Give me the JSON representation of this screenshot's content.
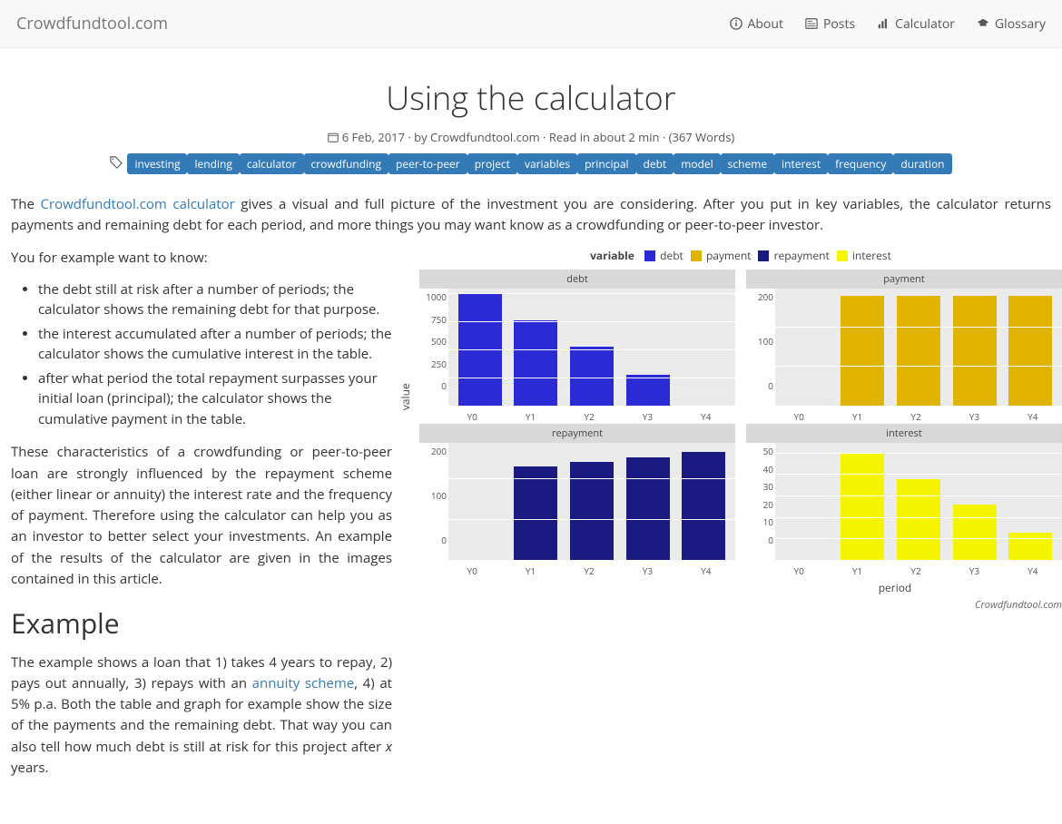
{
  "nav": {
    "brand": "Crowdfundtool.com",
    "items": [
      {
        "icon": "info",
        "label": "About"
      },
      {
        "icon": "news",
        "label": "Posts"
      },
      {
        "icon": "chart",
        "label": "Calculator"
      },
      {
        "icon": "cap",
        "label": "Glossary"
      }
    ]
  },
  "page": {
    "title": "Using the calculator",
    "meta": "6 Feb, 2017 · by Crowdfundtool.com · Read in about 2 min · (367 Words)"
  },
  "tags": [
    "investing",
    "lending",
    "calculator",
    "crowdfunding",
    "peer-to-peer",
    "project",
    "variables",
    "principal",
    "debt",
    "model",
    "scheme",
    "interest",
    "frequency",
    "duration"
  ],
  "intro": {
    "prefix": "The ",
    "link": "Crowdfundtool.com calculator",
    "rest": " gives a visual and full picture of the investment you are considering. After you put in key variables, the calculator returns payments and remaining debt for each period, and more things you may want know as a crowdfunding or peer-to-peer investor."
  },
  "know_lead": "You for example want to know:",
  "know_list": [
    "the debt still at risk after a number of periods; the calculator shows the remaining debt for that purpose.",
    "the interest accumulated after a number of periods; the calculator shows the cumulative interest in the table.",
    "after what period the total repayment surpasses your initial loan (principal); the calculator shows the cumulative payment in the table."
  ],
  "para2": "These characteristics of a crowdfunding or peer-to-peer loan are strongly influenced by the repayment scheme (either linear or annuity) the interest rate and the frequency of payment. Therefore using the calculator can help you as an investor to better select your investments. An example of the results of the calculator are given in the images contained in this article.",
  "example_heading": "Example",
  "example_para_a": "The example shows a loan that 1) takes 4 years to repay, 2) pays out annually, 3) repays with an ",
  "example_link": "annuity scheme",
  "example_para_b": ", 4) at 5% p.a. Both the table and graph for example show the size of the payments and the remaining debt. That way you can also tell how much debt is still at risk for this project after ",
  "example_ital": "x",
  "example_para_c": " years.",
  "legend": {
    "label": "variable",
    "items": [
      {
        "name": "debt",
        "color": "#2b2bd6"
      },
      {
        "name": "payment",
        "color": "#e0b400"
      },
      {
        "name": "repayment",
        "color": "#1a1a80"
      },
      {
        "name": "interest",
        "color": "#f5f500"
      }
    ]
  },
  "axis": {
    "y": "value",
    "x": "period"
  },
  "attribution": "Crowdfundtool.com",
  "chart_data": [
    {
      "type": "bar",
      "title": "debt",
      "color": "#2b2bd6",
      "categories": [
        "Y0",
        "Y1",
        "Y2",
        "Y3",
        "Y4"
      ],
      "values": [
        1000,
        770,
        530,
        280,
        0
      ],
      "yticks": [
        0,
        250,
        500,
        750,
        1000
      ],
      "ymax": 1050
    },
    {
      "type": "bar",
      "title": "payment",
      "color": "#e0b400",
      "categories": [
        "Y0",
        "Y1",
        "Y2",
        "Y3",
        "Y4"
      ],
      "values": [
        0,
        282,
        282,
        282,
        282
      ],
      "yticks": [
        0,
        100,
        200
      ],
      "ymax": 300
    },
    {
      "type": "bar",
      "title": "repayment",
      "color": "#1a1a80",
      "categories": [
        "Y0",
        "Y1",
        "Y2",
        "Y3",
        "Y4"
      ],
      "values": [
        0,
        232,
        244,
        255,
        268
      ],
      "yticks": [
        0,
        100,
        200
      ],
      "ymax": 290
    },
    {
      "type": "bar",
      "title": "interest",
      "color": "#f5f500",
      "categories": [
        "Y0",
        "Y1",
        "Y2",
        "Y3",
        "Y4"
      ],
      "values": [
        0,
        50,
        38,
        26,
        13
      ],
      "yticks": [
        0,
        10,
        20,
        30,
        40,
        50
      ],
      "ymax": 55
    }
  ]
}
